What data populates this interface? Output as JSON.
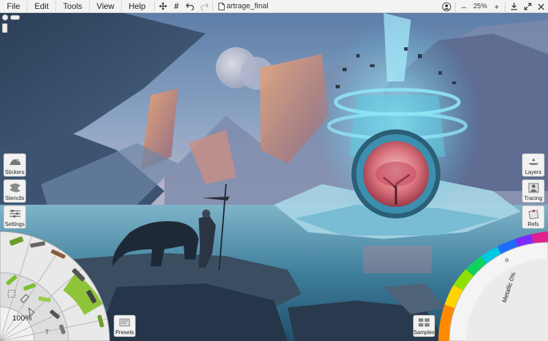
{
  "menubar": {
    "items": [
      "File",
      "Edit",
      "Tools",
      "View",
      "Help"
    ],
    "document_name": "artrage_final",
    "zoom": "25%"
  },
  "left_panel": {
    "stickers": "Stickers",
    "stencils": "Stencils",
    "settings": "Settings"
  },
  "right_panel": {
    "layers": "Layers",
    "tracing": "Tracing",
    "refs": "Refs"
  },
  "toolwheel": {
    "zoom": "100%"
  },
  "bottom": {
    "presets": "Presets",
    "samples": "Samples"
  },
  "colorpicker": {
    "metallic": "Metallic 0%"
  },
  "colors": {
    "menubar_bg": "#f3f3f3",
    "panel_bg": "#f2f2f2",
    "active_tool": "#8fc43a"
  }
}
